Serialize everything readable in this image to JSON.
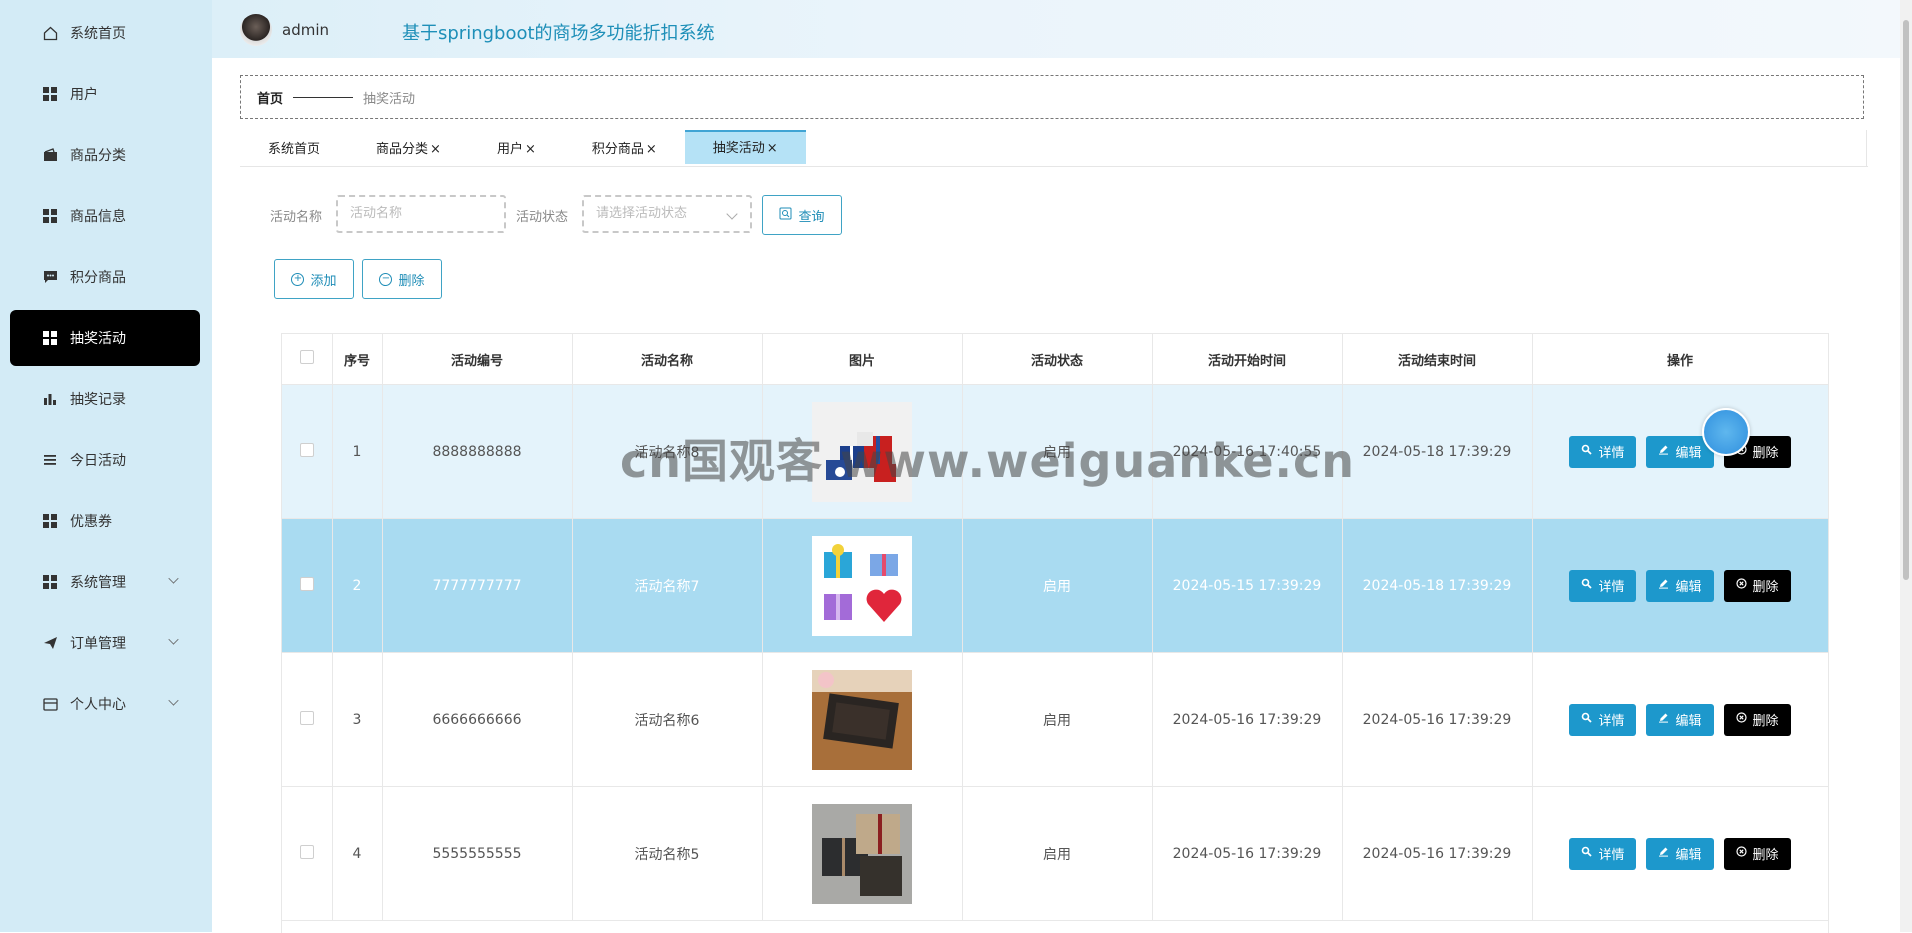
{
  "header": {
    "username": "admin",
    "site_title": "基于springboot的商场多功能折扣系统"
  },
  "sidebar": {
    "items": [
      {
        "label": "系统首页",
        "icon": "home-icon"
      },
      {
        "label": "用户",
        "icon": "grid-icon"
      },
      {
        "label": "商品分类",
        "icon": "wallet-icon"
      },
      {
        "label": "商品信息",
        "icon": "grid-icon"
      },
      {
        "label": "积分商品",
        "icon": "chat-icon"
      },
      {
        "label": "抽奖活动",
        "icon": "grid-icon",
        "active": true
      },
      {
        "label": "抽奖记录",
        "icon": "bar-chart-icon"
      },
      {
        "label": "今日活动",
        "icon": "list-icon"
      },
      {
        "label": "优惠券",
        "icon": "grid-icon"
      },
      {
        "label": "系统管理",
        "icon": "grid-icon",
        "expandable": true
      },
      {
        "label": "订单管理",
        "icon": "send-icon",
        "expandable": true
      },
      {
        "label": "个人中心",
        "icon": "card-icon",
        "expandable": true
      }
    ]
  },
  "breadcrumb": {
    "home": "首页",
    "current": "抽奖活动"
  },
  "tabs": [
    {
      "label": "系统首页",
      "closable": false
    },
    {
      "label": "商品分类",
      "closable": true
    },
    {
      "label": "用户",
      "closable": true
    },
    {
      "label": "积分商品",
      "closable": true
    },
    {
      "label": "抽奖活动",
      "closable": true,
      "active": true
    }
  ],
  "tab_close_symbol": "×",
  "search": {
    "name_label": "活动名称",
    "name_placeholder": "活动名称",
    "status_label": "活动状态",
    "status_placeholder": "请选择活动状态",
    "query_label": "查询"
  },
  "toolbar": {
    "add_label": "添加",
    "delete_label": "删除"
  },
  "table": {
    "headers": [
      "序号",
      "活动编号",
      "活动名称",
      "图片",
      "活动状态",
      "活动开始时间",
      "活动结束时间",
      "操作"
    ],
    "rows": [
      {
        "index": "1",
        "code": "8888888888",
        "name": "活动名称8",
        "status": "启用",
        "start": "2024-05-16 17:40:55",
        "end": "2024-05-18 17:39:29",
        "image": "gift-boxes-red-blue"
      },
      {
        "index": "2",
        "code": "7777777777",
        "name": "活动名称7",
        "status": "启用",
        "start": "2024-05-15 17:39:29",
        "end": "2024-05-18 17:39:29",
        "image": "gift-boxes-four"
      },
      {
        "index": "3",
        "code": "6666666666",
        "name": "活动名称6",
        "status": "启用",
        "start": "2024-05-16 17:39:29",
        "end": "2024-05-16 17:39:29",
        "image": "gift-box-wood"
      },
      {
        "index": "4",
        "code": "5555555555",
        "name": "活动名称5",
        "status": "启用",
        "start": "2024-05-16 17:39:29",
        "end": "2024-05-16 17:39:29",
        "image": "gift-boxes-dark"
      }
    ],
    "actions": {
      "detail": "详情",
      "edit": "编辑",
      "delete": "删除"
    }
  },
  "watermark": "cn国观客 www.weiguanke.cn",
  "colors": {
    "sidebar_bg": "#d3ebf6",
    "active_menu_bg": "#000000",
    "accent": "#1d98cc",
    "selected_row": "#a9dbf1",
    "hover_row": "#e4f3fb",
    "title_color": "#1e8fb8"
  }
}
